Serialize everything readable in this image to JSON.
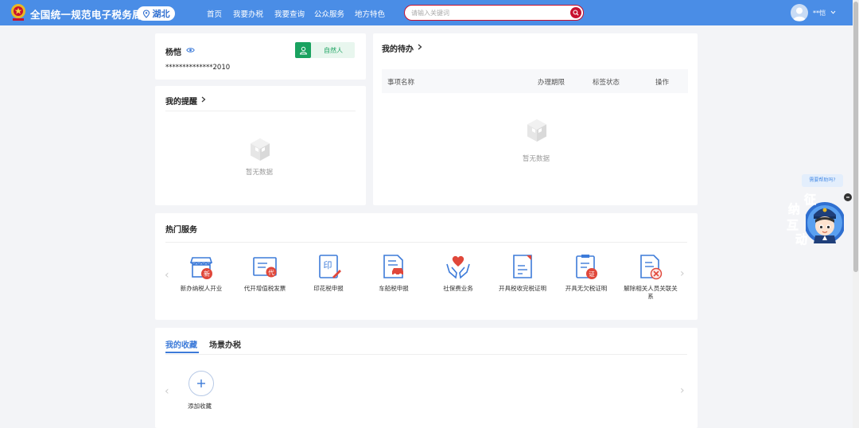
{
  "header": {
    "title": "全国统一规范电子税务局",
    "region": "湖北",
    "nav": [
      "首页",
      "我要办税",
      "我要查询",
      "公众服务",
      "地方特色"
    ],
    "search_placeholder": "请输入关键词",
    "username": "**恺"
  },
  "profile": {
    "name": "杨恺",
    "id_masked": "**************2010",
    "role": "自然人"
  },
  "reminders": {
    "title": "我的提醒",
    "empty": "暂无数据"
  },
  "todo": {
    "title": "我的待办",
    "columns": [
      "事项名称",
      "办理期限",
      "标签状态",
      "操作"
    ],
    "empty": "暂无数据"
  },
  "hot_services": {
    "title": "热门服务",
    "items": [
      {
        "label": "新办纳税人开业",
        "icon": "shop-new-icon"
      },
      {
        "label": "代开增值税发票",
        "icon": "invoice-icon"
      },
      {
        "label": "印花税申报",
        "icon": "stamp-icon"
      },
      {
        "label": "车船税申报",
        "icon": "car-doc-icon"
      },
      {
        "label": "社保费业务",
        "icon": "heart-hands-icon"
      },
      {
        "label": "开具税收完税证明",
        "icon": "certificate-icon"
      },
      {
        "label": "开具无欠税证明",
        "icon": "clipboard-icon"
      },
      {
        "label": "解除相关人员关联关系",
        "icon": "unlink-doc-icon"
      }
    ]
  },
  "favorites": {
    "tabs": [
      "我的收藏",
      "场景办税"
    ],
    "add_label": "添加收藏"
  },
  "assistant": {
    "bubble": "需要帮助吗?",
    "chars": [
      "征",
      "纳",
      "互",
      "动"
    ]
  },
  "colors": {
    "header": "#4a8de6",
    "accent_blue": "#3d7bd9",
    "green": "#1aa260",
    "red": "#c8102e"
  }
}
